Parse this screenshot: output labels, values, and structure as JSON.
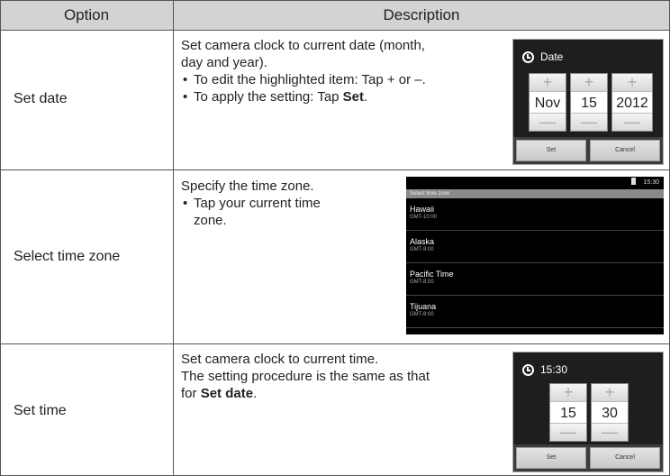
{
  "header": {
    "option": "Option",
    "description": "Description"
  },
  "rows": [
    {
      "option": "Set date",
      "desc_lines": [
        "Set camera clock to current date (month,",
        "day and year)."
      ],
      "bullet1": "To edit the highlighted item: Tap + or –.",
      "bullet2_prefix": "To apply the setting: Tap ",
      "bullet2_bold": "Set",
      "bullet2_suffix": "."
    },
    {
      "option": "Select time zone",
      "desc_line": "Specify the time zone.",
      "bullet1_line1": "Tap your current time",
      "bullet1_line2": "zone."
    },
    {
      "option": "Set time",
      "desc_line1": "Set camera clock to current time.",
      "desc_line2": "The setting procedure is the same as that",
      "desc_line3_prefix": "for ",
      "desc_line3_bold": "Set date",
      "desc_line3_suffix": "."
    }
  ],
  "date_screen": {
    "title": "Date",
    "plus": "+",
    "minus": "—",
    "month": "Nov",
    "day": "15",
    "year": "2012",
    "set": "Set",
    "cancel": "Cancel",
    "icon": "clock-icon"
  },
  "tz_screen": {
    "status_time": "15:30",
    "header": "Select time zone",
    "items": [
      {
        "name": "Hawaii",
        "gmt": "GMT-10:00"
      },
      {
        "name": "Alaska",
        "gmt": "GMT-9:00"
      },
      {
        "name": "Pacific Time",
        "gmt": "GMT-8:00"
      },
      {
        "name": "Tijuana",
        "gmt": "GMT-8:00"
      }
    ]
  },
  "time_screen": {
    "title": "15:30",
    "plus": "+",
    "minus": "—",
    "hour": "15",
    "minute": "30",
    "set": "Set",
    "cancel": "Cancel",
    "icon": "clock-icon"
  }
}
